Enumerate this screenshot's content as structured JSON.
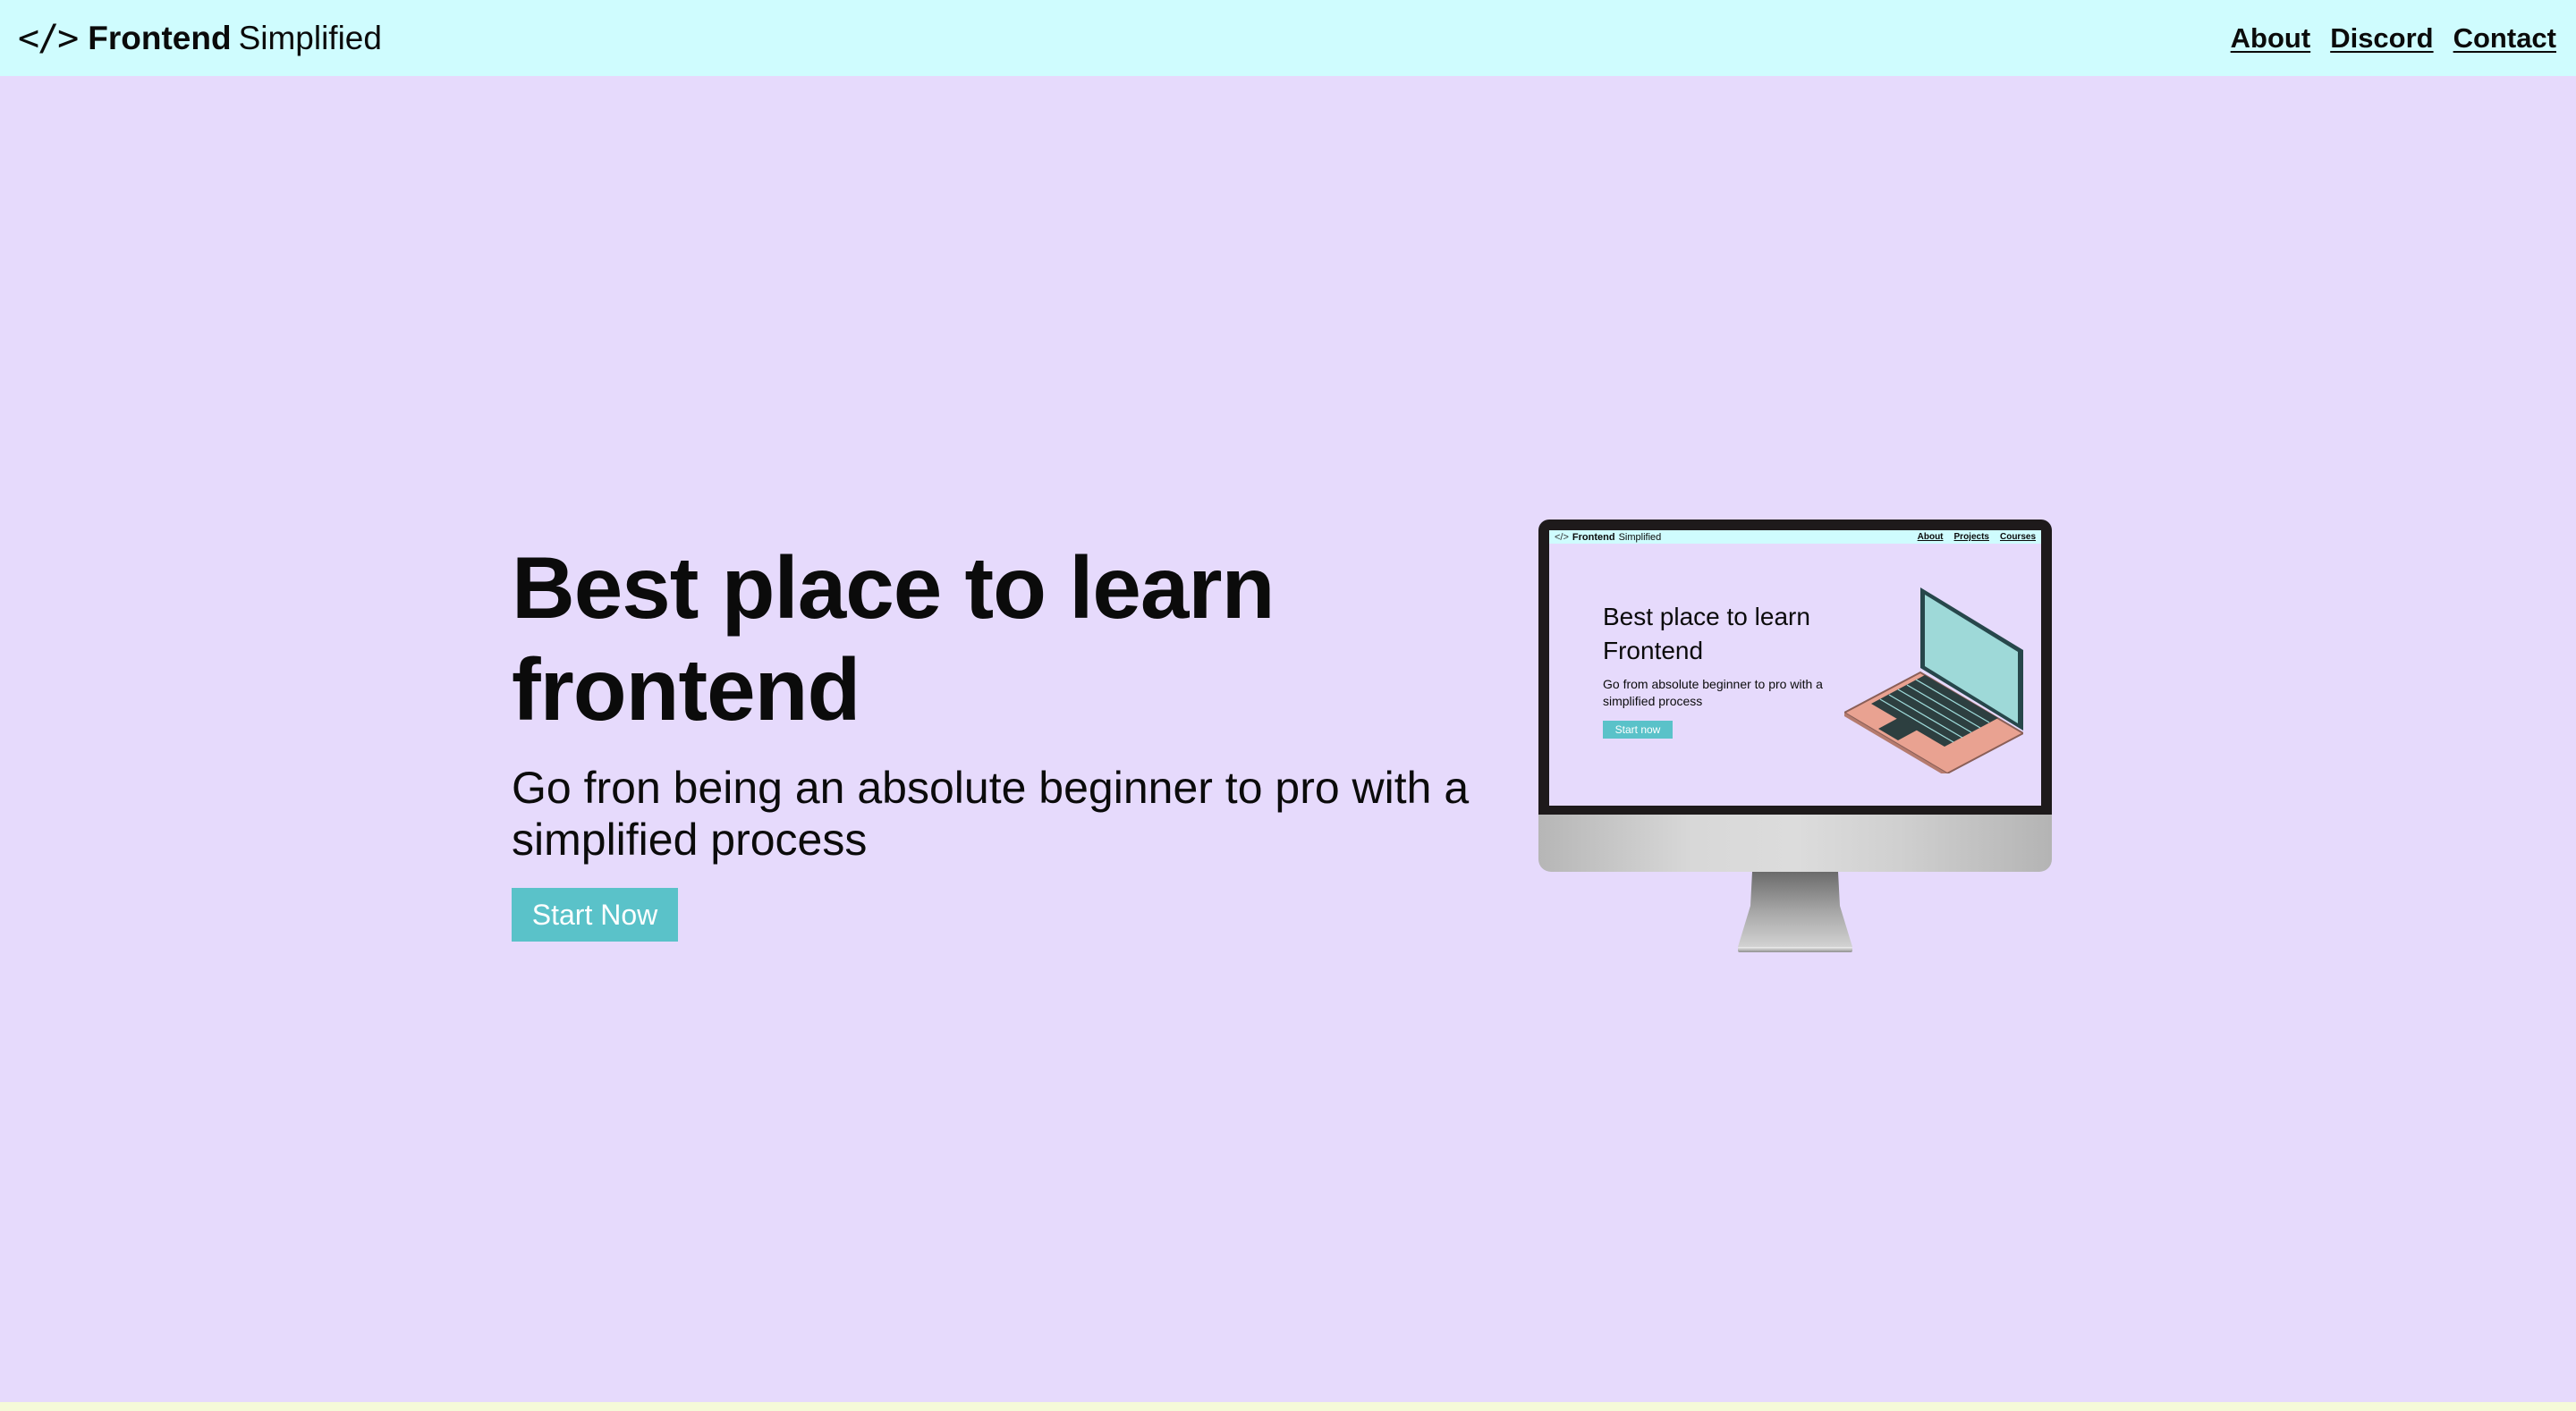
{
  "header": {
    "logo_symbol": "</>",
    "brand_bold": "Frontend",
    "brand_light": "Simplified",
    "links": [
      "About",
      "Discord",
      "Contact"
    ]
  },
  "hero": {
    "title_line1": "Best place to learn",
    "title_line2": "frontend",
    "subtitle_line1": "Go fron being an absolute beginner to pro with a",
    "subtitle_line2": "simplified process",
    "cta_label": "Start Now"
  },
  "illustration": {
    "mini_logo_symbol": "</>",
    "mini_brand_bold": "Frontend",
    "mini_brand_light": "Simplified",
    "mini_links": [
      "About",
      "Projects",
      "Courses"
    ],
    "mini_title_line1": "Best place to learn",
    "mini_title_line2": "Frontend",
    "mini_sub_line1": "Go from absolute beginner to pro with a",
    "mini_sub_line2": "simplified process",
    "mini_cta": "Start now"
  },
  "colors": {
    "page_bg": "#e6dafc",
    "header_bg": "#cffcfe",
    "accent": "#5ac2c9",
    "text": "#0b0b0b"
  }
}
